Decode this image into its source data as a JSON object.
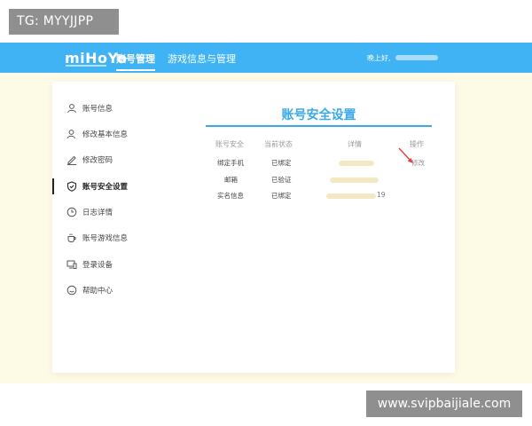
{
  "badge": {
    "text": "TG: MYYJJPP"
  },
  "header": {
    "logo": "miHoYo",
    "tabs": [
      {
        "label": "账号管理",
        "active": true
      },
      {
        "label": "游戏信息与管理",
        "active": false
      }
    ],
    "greeting": "晚上好,"
  },
  "sidebar": {
    "items": [
      {
        "label": "账号信息",
        "icon": "user-icon"
      },
      {
        "label": "修改基本信息",
        "icon": "user-edit-icon"
      },
      {
        "label": "修改密码",
        "icon": "pencil-icon"
      },
      {
        "label": "账号安全设置",
        "icon": "shield-icon",
        "active": true
      },
      {
        "label": "日志详情",
        "icon": "clock-icon"
      },
      {
        "label": "账号游戏信息",
        "icon": "cup-icon"
      },
      {
        "label": "登录设备",
        "icon": "device-icon"
      },
      {
        "label": "帮助中心",
        "icon": "help-icon"
      }
    ]
  },
  "main": {
    "title": "账号安全设置",
    "columns": [
      "账号安全",
      "当前状态",
      "详情",
      "操作"
    ],
    "rows": [
      {
        "item": "绑定手机",
        "status": "已绑定",
        "detail": "",
        "action": "修改"
      },
      {
        "item": "邮箱",
        "status": "已验证",
        "detail": "",
        "action": ""
      },
      {
        "item": "实名信息",
        "status": "已绑定",
        "detail": "19",
        "action": ""
      }
    ]
  },
  "watermark": {
    "text": "www.svipbaijiale.com"
  },
  "colors": {
    "header": "#3fb3f3",
    "accent": "#3aa9e8",
    "background": "#fdfae6",
    "arrow": "#e0413a"
  }
}
